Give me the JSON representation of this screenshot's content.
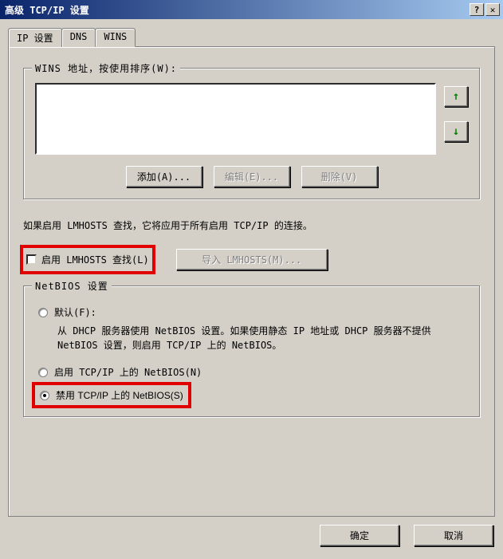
{
  "titlebar": {
    "title": "高级 TCP/IP 设置"
  },
  "tabs": {
    "ip": "IP 设置",
    "dns": "DNS",
    "wins": "WINS"
  },
  "wins": {
    "group_label": "WINS 地址，按使用排序(W):",
    "add": "添加(A)...",
    "edit": "编辑(E)...",
    "remove": "删除(V)"
  },
  "lmhosts": {
    "info": "如果启用 LMHOSTS 查找，它将应用于所有启用 TCP/IP 的连接。",
    "enable_label": "启用 LMHOSTS 查找(L)",
    "import_label": "导入 LMHOSTS(M)..."
  },
  "netbios": {
    "group_label": "NetBIOS 设置",
    "default_label": "默认(F):",
    "default_desc": "从 DHCP 服务器使用 NetBIOS 设置。如果使用静态 IP 地址或 DHCP 服务器不提供 NetBIOS 设置，则启用 TCP/IP 上的 NetBIOS。",
    "enable_label": "启用 TCP/IP 上的 NetBIOS(N)",
    "disable_label": "禁用 TCP/IP 上的 NetBIOS(S)"
  },
  "buttons": {
    "ok": "确定",
    "cancel": "取消"
  }
}
